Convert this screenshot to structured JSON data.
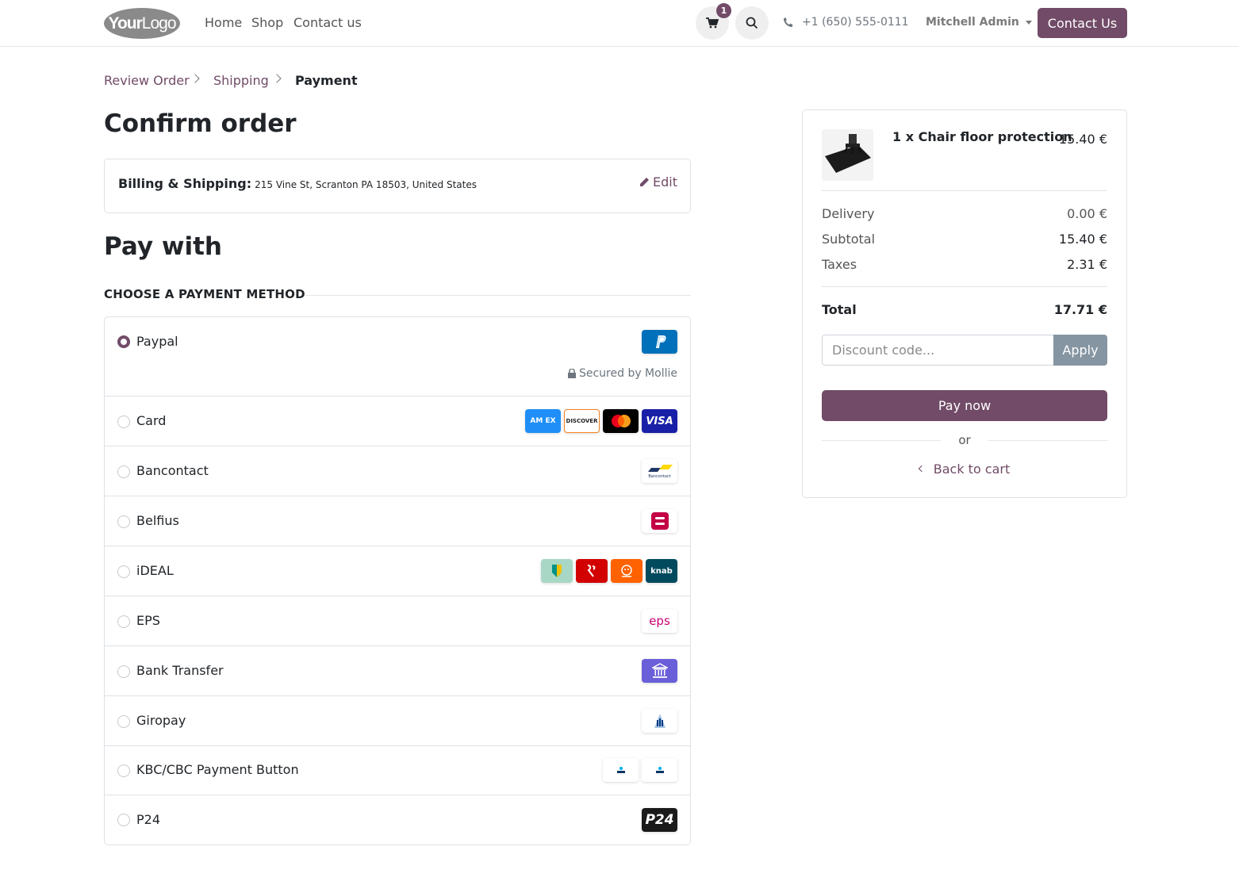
{
  "header": {
    "logo": {
      "text_bold": "Your",
      "text_light": "Logo"
    },
    "nav": [
      "Home",
      "Shop",
      "Contact us"
    ],
    "cart_count": "1",
    "phone": "+1 (650) 555-0111",
    "user": "Mitchell Admin",
    "contact_button": "Contact Us"
  },
  "breadcrumb": [
    {
      "label": "Review Order"
    },
    {
      "label": "Shipping"
    },
    {
      "label": "Payment"
    }
  ],
  "page_title": "Confirm order",
  "billing": {
    "label": "Billing & Shipping:",
    "address": "215 Vine St, Scranton PA 18503, United States",
    "edit": "Edit"
  },
  "pay_with": "Pay with",
  "choose_label": "CHOOSE A PAYMENT METHOD",
  "methods": [
    {
      "name": "Paypal",
      "checked": true,
      "secured": "Secured by Mollie"
    },
    {
      "name": "Card"
    },
    {
      "name": "Bancontact"
    },
    {
      "name": "Belfius"
    },
    {
      "name": "iDEAL"
    },
    {
      "name": "EPS"
    },
    {
      "name": "Bank Transfer"
    },
    {
      "name": "Giropay"
    },
    {
      "name": "KBC/CBC Payment Button"
    },
    {
      "name": "P24"
    }
  ],
  "logo_text": {
    "amex": "AM EX",
    "discover": "DISCOVER",
    "visa": "VISA",
    "bancontact": "Bancontact",
    "knab": "knab",
    "eps": "eps",
    "p24": "P24"
  },
  "summary": {
    "product": "1 x Chair floor protection",
    "product_price": "15.40 €",
    "lines": [
      {
        "label": "Delivery",
        "value": "0.00 €"
      },
      {
        "label": "Subtotal",
        "value": "15.40 €"
      },
      {
        "label": "Taxes",
        "value": "2.31 €"
      }
    ],
    "total_label": "Total",
    "total_value": "17.71 €",
    "discount_placeholder": "Discount code...",
    "apply": "Apply",
    "pay_now": "Pay now",
    "or": "or",
    "back": "Back to cart"
  },
  "colors": {
    "primary": "#714b67",
    "apply_button": "#8595a2"
  }
}
